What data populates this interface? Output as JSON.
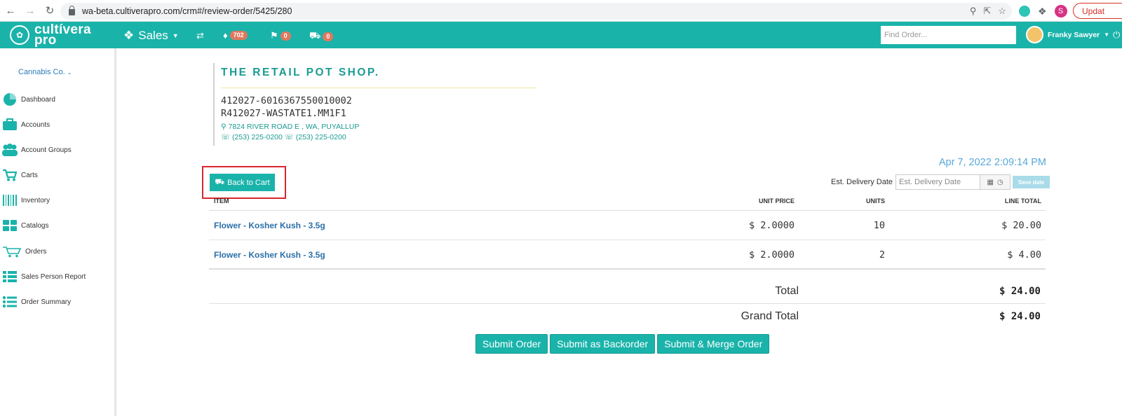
{
  "browser": {
    "url": "wa-beta.cultiverapro.com/crm#/review-order/5425/280",
    "profile_initial": "S",
    "update_label": "Updat"
  },
  "header": {
    "logo_line1": "cultívera",
    "logo_line2": "pro",
    "sales_label": "Sales",
    "notifications_count": "702",
    "flags_count": "0",
    "cart_count": "0",
    "find_order_placeholder": "Find Order...",
    "user_name": "Franky Sawyer"
  },
  "sidebar": {
    "company": "Cannabis Co.",
    "items": [
      {
        "label": "Dashboard"
      },
      {
        "label": "Accounts"
      },
      {
        "label": "Account Groups"
      },
      {
        "label": "Carts"
      },
      {
        "label": "Inventory"
      },
      {
        "label": "Catalogs"
      },
      {
        "label": "Orders"
      },
      {
        "label": "Sales Person Report"
      },
      {
        "label": "Order Summary"
      }
    ]
  },
  "shop": {
    "name": "THE RETAIL POT SHOP.",
    "id_line1": "412027-6016367550010002",
    "id_line2": "R412027-WASTATE1.MM1F1",
    "address": "7824 RIVER ROAD E , WA, PUYALLUP",
    "phone1": "(253) 225-0200",
    "phone2": "(253) 225-0200"
  },
  "order": {
    "date": "Apr 7, 2022 2:09:14 PM",
    "back_to_cart_label": "Back to Cart",
    "delivery_label": "Est. Delivery Date",
    "delivery_placeholder": "Est. Delivery Date",
    "save_date_label": "Save date",
    "columns": {
      "item": "ITEM",
      "unit_price": "UNIT PRICE",
      "units": "UNITS",
      "line_total": "LINE TOTAL"
    },
    "rows": [
      {
        "item": "Flower - Kosher Kush - 3.5g",
        "unit_price": "$ 2.0000",
        "units": "10",
        "line_total": "$ 20.00"
      },
      {
        "item": "Flower - Kosher Kush - 3.5g",
        "unit_price": "$ 2.0000",
        "units": "2",
        "line_total": "$ 4.00"
      }
    ],
    "total_label": "Total",
    "total_value": "$ 24.00",
    "grand_total_label": "Grand Total",
    "grand_total_value": "$ 24.00",
    "submit_order_label": "Submit Order",
    "submit_backorder_label": "Submit as Backorder",
    "submit_merge_label": "Submit & Merge Order"
  },
  "colors": {
    "brand_teal": "#1ab3aa",
    "link_blue": "#2b6ea8",
    "highlight_red": "#d9262c"
  }
}
